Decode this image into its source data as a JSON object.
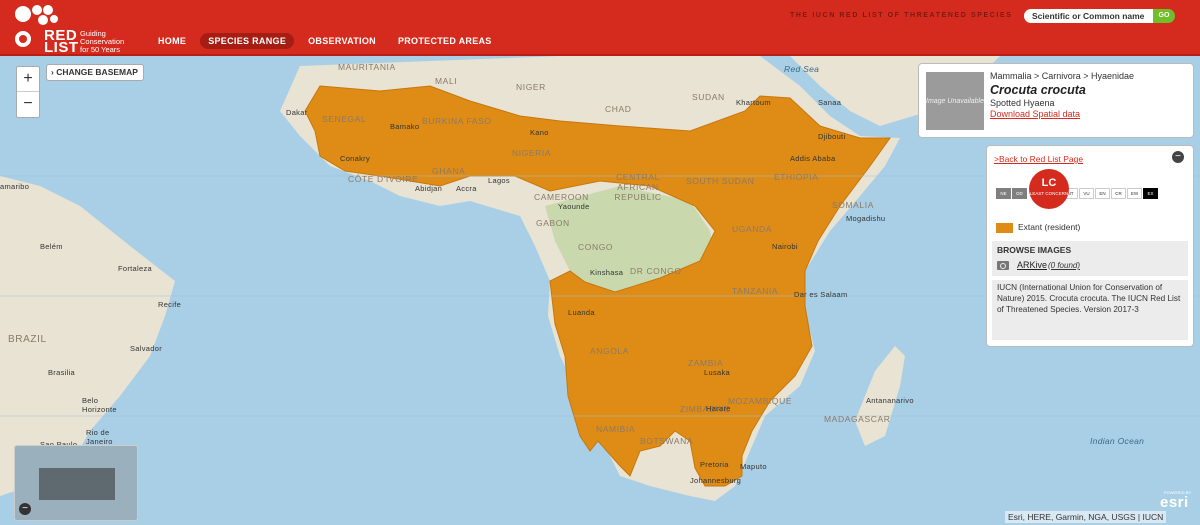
{
  "header": {
    "logo": {
      "word_line1": "RED",
      "word_line2": "LIST",
      "tagline_1": "Guiding",
      "tagline_2": "Conservation",
      "tagline_3": "for 50 Years"
    },
    "nav": [
      {
        "label": "HOME"
      },
      {
        "label": "SPECIES RANGE",
        "active": true
      },
      {
        "label": "OBSERVATION"
      },
      {
        "label": "PROTECTED AREAS"
      }
    ],
    "site_title": "THE IUCN RED LIST OF THREATENED SPECIES",
    "search_placeholder": "Scientific or Common name",
    "search_button": "GO"
  },
  "map_controls": {
    "zoom_in": "+",
    "zoom_out": "−",
    "basemap_label": "CHANGE BASEMAP"
  },
  "map_labels": {
    "countries": [
      "MAURITANIA",
      "MALI",
      "NIGER",
      "CHAD",
      "SUDAN",
      "SENEGAL",
      "BURKINA FASO",
      "NIGERIA",
      "GHANA",
      "CÔTE D'IVOIRE",
      "CENTRAL AFRICAN REPUBLIC",
      "SOUTH SUDAN",
      "ETHIOPIA",
      "SOMALIA",
      "CAMEROON",
      "GABON",
      "CONGO",
      "DR CONGO",
      "UGANDA",
      "TANZANIA",
      "ANGOLA",
      "ZAMBIA",
      "ZIMBABWE",
      "MOZAMBIQUE",
      "NAMIBIA",
      "BOTSWANA",
      "MADAGASCAR",
      "BRAZIL"
    ],
    "cities": [
      "Dakar",
      "Bamako",
      "Conakry",
      "Abidjan",
      "Accra",
      "Lagos",
      "Kano",
      "Yaounde",
      "Khartoum",
      "Sanaa",
      "Djibouti",
      "Addis Ababa",
      "Mogadishu",
      "Nairobi",
      "Kinshasa",
      "Luanda",
      "Dar es Salaam",
      "Lusaka",
      "Harare",
      "Antananarivo",
      "Pretoria",
      "Maputo",
      "Johannesburg",
      "Belém",
      "Fortaleza",
      "Recife",
      "Salvador",
      "Brasilia",
      "Belo Horizonte",
      "Rio de Janeiro",
      "Sao Paulo",
      "amaribo"
    ],
    "oceans": [
      "Red Sea",
      "Indian Ocean"
    ]
  },
  "species": {
    "image_text": "Image Unavailable",
    "taxonomy": "Mammalia > Carnivora > Hyaenidae",
    "scientific_name": "Crocuta crocuta",
    "common_name": "Spotted Hyaena",
    "download_link": "Download Spatial data"
  },
  "info_panel": {
    "back_link": ">Back to Red List Page",
    "collapse_icon": "−",
    "status_code": "LC",
    "status_name": "LEAST CONCERN",
    "categories": [
      "NE",
      "DD",
      "NT",
      "VU",
      "EN",
      "CR",
      "EW",
      "EX"
    ],
    "legend_label": "Extant (resident)",
    "legend_color": "#de8c16",
    "browse_title": "BROWSE IMAGES",
    "arkive_label": "ARKive",
    "arkive_count": "(0 found)",
    "citation": "IUCN (International Union for Conservation of Nature) 2015. Crocuta crocuta. The IUCN Red List of Threatened Species. Version 2017-3"
  },
  "footer": {
    "esri_powered": "POWERED BY",
    "esri_logo": "esri",
    "attribution": "Esri, HERE, Garmin, NGA, USGS | IUCN"
  },
  "colors": {
    "header_red": "#d52b1e",
    "range_orange": "#de8c16",
    "ocean": "#a9cfe6",
    "land": "#e8e3d3"
  }
}
